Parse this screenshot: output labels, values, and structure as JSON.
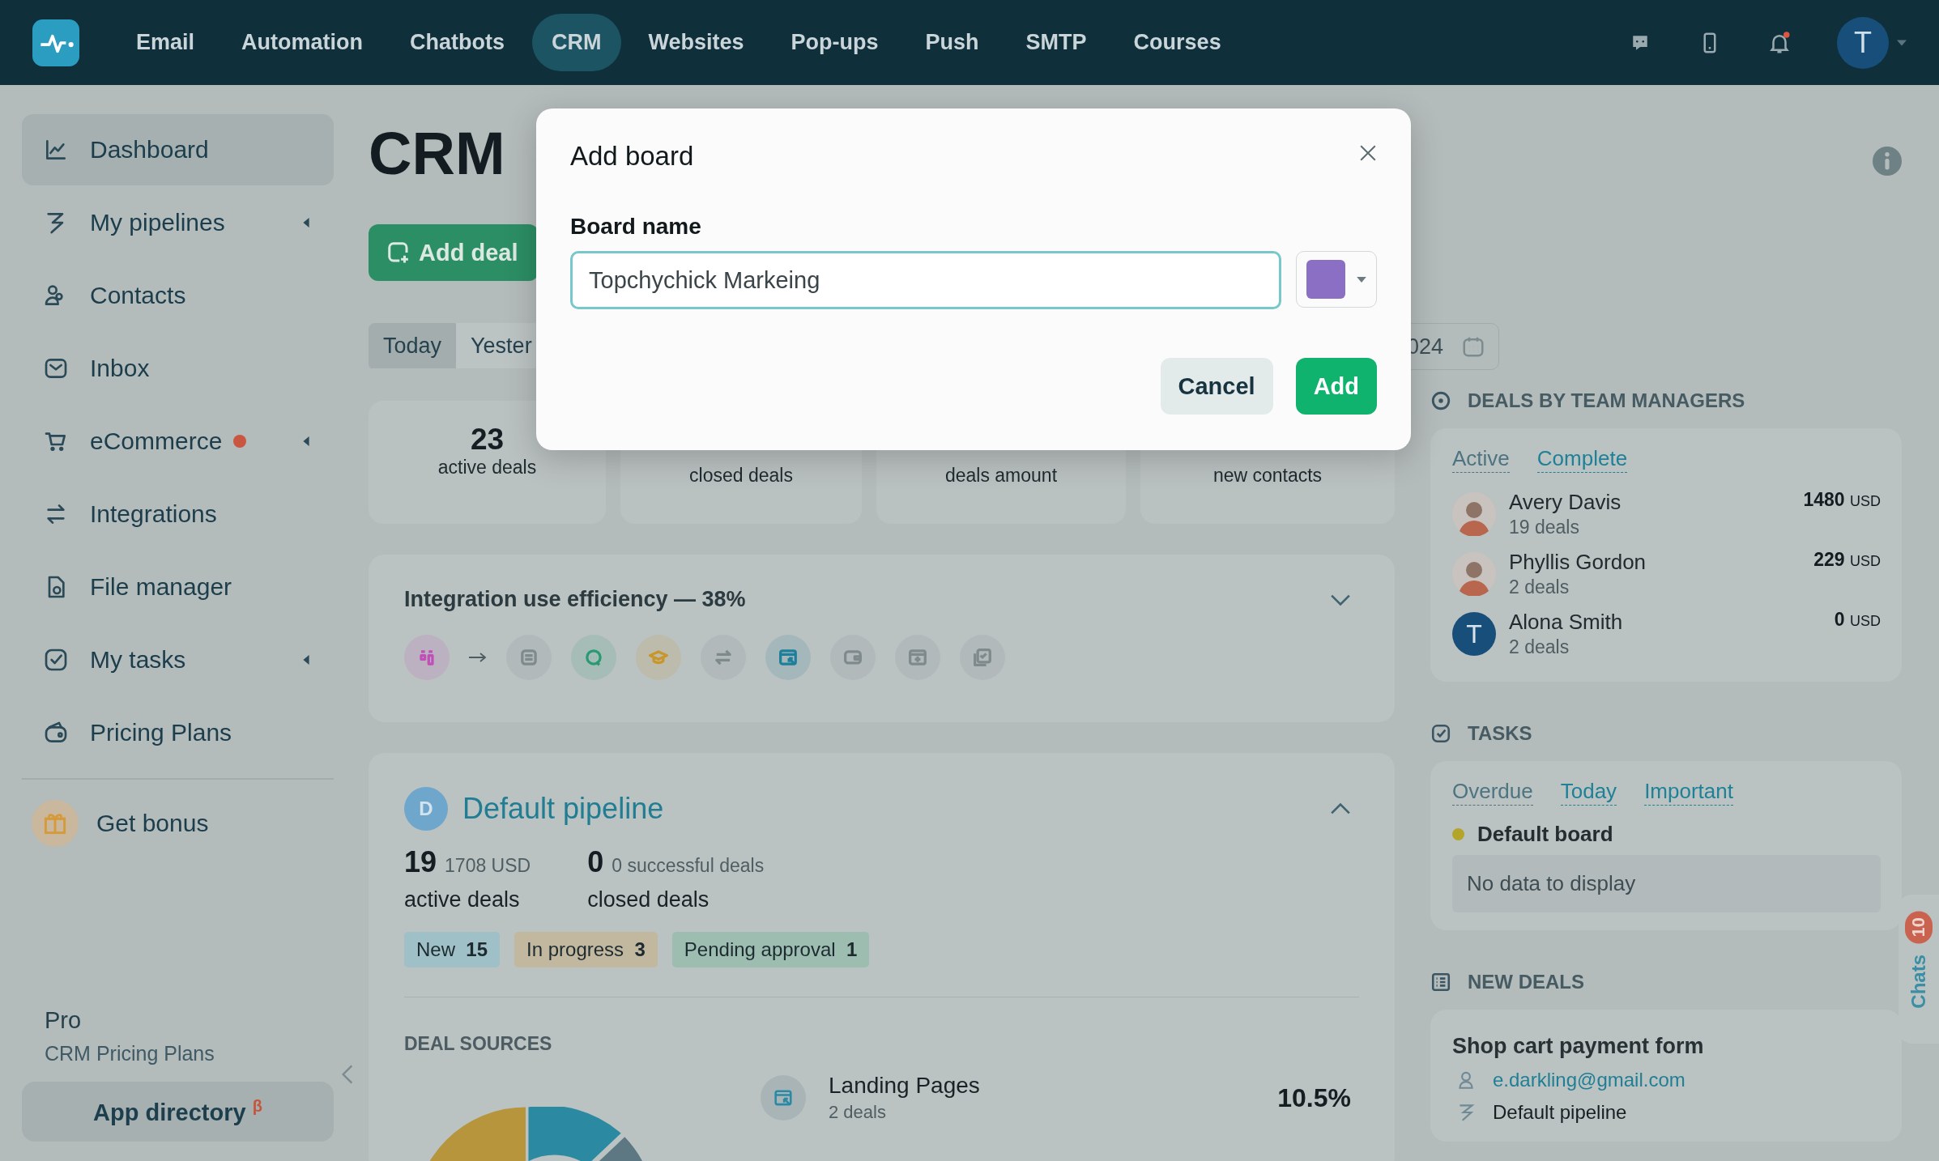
{
  "topbar": {
    "nav": [
      {
        "label": "Email",
        "selected": false
      },
      {
        "label": "Automation",
        "selected": false
      },
      {
        "label": "Chatbots",
        "selected": false
      },
      {
        "label": "CRM",
        "selected": true
      },
      {
        "label": "Websites",
        "selected": false
      },
      {
        "label": "Pop-ups",
        "selected": false
      },
      {
        "label": "Push",
        "selected": false
      },
      {
        "label": "SMTP",
        "selected": false
      },
      {
        "label": "Courses",
        "selected": false
      }
    ],
    "avatar": "T"
  },
  "sidebar": {
    "items": [
      {
        "label": "Dashboard",
        "selected": true,
        "expandable": false,
        "alert": false
      },
      {
        "label": "My pipelines",
        "selected": false,
        "expandable": true,
        "alert": false
      },
      {
        "label": "Contacts",
        "selected": false,
        "expandable": false,
        "alert": false
      },
      {
        "label": "Inbox",
        "selected": false,
        "expandable": false,
        "alert": false
      },
      {
        "label": "eCommerce",
        "selected": false,
        "expandable": true,
        "alert": true
      },
      {
        "label": "Integrations",
        "selected": false,
        "expandable": false,
        "alert": false
      },
      {
        "label": "File manager",
        "selected": false,
        "expandable": false,
        "alert": false
      },
      {
        "label": "My tasks",
        "selected": false,
        "expandable": true,
        "alert": false
      },
      {
        "label": "Pricing Plans",
        "selected": false,
        "expandable": false,
        "alert": false
      }
    ],
    "bonus": "Get bonus",
    "plan": "Pro",
    "plan_link": "CRM Pricing Plans",
    "app_directory": "App directory $^{β}$"
  },
  "header": {
    "title": "CRM",
    "add_deal": "Add deal",
    "periods": [
      {
        "label": "Today",
        "selected": true
      },
      {
        "label": "Yester",
        "selected": false
      }
    ],
    "date_field": "024"
  },
  "stats": [
    {
      "value": "23",
      "label": "active deals"
    },
    {
      "label": "closed deals"
    },
    {
      "label": "deals amount"
    },
    {
      "label": "new contacts"
    }
  ],
  "efficiency": {
    "title": "Integration use efficiency — 38%",
    "expanded": false,
    "steps": [
      {
        "color": "#c04fb8"
      },
      {
        "color": "#7e8a8c"
      },
      {
        "color": "#2a9a72"
      },
      {
        "color": "#c9962a"
      },
      {
        "color": "#7e8a8c"
      },
      {
        "color": "#1f7f9a"
      },
      {
        "color": "#7e8a8c"
      },
      {
        "color": "#7e8a8c"
      },
      {
        "color": "#7e8a8c"
      }
    ]
  },
  "pipeline": {
    "avatar": "D",
    "title": "Default pipeline",
    "expanded": true,
    "active_count": "19",
    "active_amount": "1708 USD",
    "active_label": "active deals",
    "closed_count": "0",
    "closed_note": "0 successful deals",
    "closed_label": "closed deals",
    "stages": [
      {
        "label": "New",
        "count": "15",
        "color": "#9fc0c6"
      },
      {
        "label": "In progress",
        "count": "3",
        "color": "#c2b8a0"
      },
      {
        "label": "Pending approval",
        "count": "1",
        "color": "#9cbdb0"
      }
    ]
  },
  "deal_sources": {
    "title": "DEAL SOURCES",
    "sources": [
      {
        "name": "Landing Pages",
        "deals": "2 deals",
        "share": "10.5%"
      }
    ]
  },
  "managers": {
    "title": "DEALS BY TEAM MANAGERS",
    "tabs": [
      {
        "label": "Active",
        "selected": true
      },
      {
        "label": "Complete",
        "selected": false
      }
    ],
    "rows": [
      {
        "name": "Avery Davis",
        "deals": "19 deals",
        "amount": "1480",
        "currency": "USD"
      },
      {
        "name": "Phyllis Gordon",
        "deals": "2 deals",
        "amount": "229",
        "currency": "USD"
      },
      {
        "name": "Alona Smith",
        "deals": "2 deals",
        "amount": "0",
        "currency": "USD",
        "avatar": {
          "kind": "letter",
          "letter": "T"
        }
      }
    ]
  },
  "tasks": {
    "title": "TASKS",
    "tabs": [
      {
        "label": "Overdue",
        "selected": true
      },
      {
        "label": "Today",
        "selected": false
      },
      {
        "label": "Important",
        "selected": false
      }
    ],
    "board": {
      "name": "Default board",
      "color": "#b3a52a"
    },
    "empty": "No data to display"
  },
  "new_deals": {
    "title": "NEW DEALS",
    "deal": {
      "title": "Shop cart payment form",
      "email": "e.darkling@gmail.com",
      "pipeline": "Default pipeline"
    }
  },
  "chats": {
    "label": "Chats",
    "count": "10"
  },
  "modal": {
    "title": "Add board",
    "field_label": "Board name",
    "value": "Topchychick Markeing",
    "color": "#8a6fc4",
    "buttons": [
      {
        "label": "Cancel",
        "kind": "secondary"
      },
      {
        "label": "Add",
        "kind": "primary"
      }
    ]
  }
}
